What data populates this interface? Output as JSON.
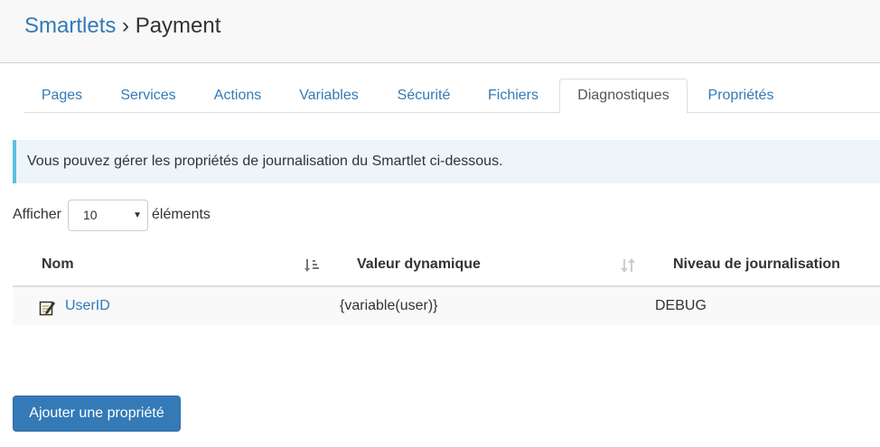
{
  "header": {
    "breadcrumb_root": "Smartlets",
    "breadcrumb_sep": "›",
    "breadcrumb_current": "Payment"
  },
  "tabs": [
    {
      "label": "Pages"
    },
    {
      "label": "Services"
    },
    {
      "label": "Actions"
    },
    {
      "label": "Variables"
    },
    {
      "label": "Sécurité"
    },
    {
      "label": "Fichiers"
    },
    {
      "label": "Diagnostiques",
      "active": true
    },
    {
      "label": "Propriétés"
    }
  ],
  "alert": {
    "text": "Vous pouvez gérer les propriétés de journalisation du Smartlet ci-dessous."
  },
  "length": {
    "label_before": "Afficher",
    "selected": "10",
    "label_after": "éléments"
  },
  "table": {
    "columns": [
      {
        "label": "Nom",
        "sort": "desc-active"
      },
      {
        "label": "Valeur dynamique",
        "sort": "both"
      },
      {
        "label": "Niveau de journalisation"
      }
    ],
    "rows": [
      {
        "name": "UserID",
        "value": "{variable(user)}",
        "level": "DEBUG"
      }
    ]
  },
  "actions": {
    "add_label": "Ajouter une propriété"
  },
  "colors": {
    "link": "#337ab7",
    "primary": "#337ab7",
    "alert_border": "#5bc0de",
    "alert_bg": "#eef5fa"
  }
}
